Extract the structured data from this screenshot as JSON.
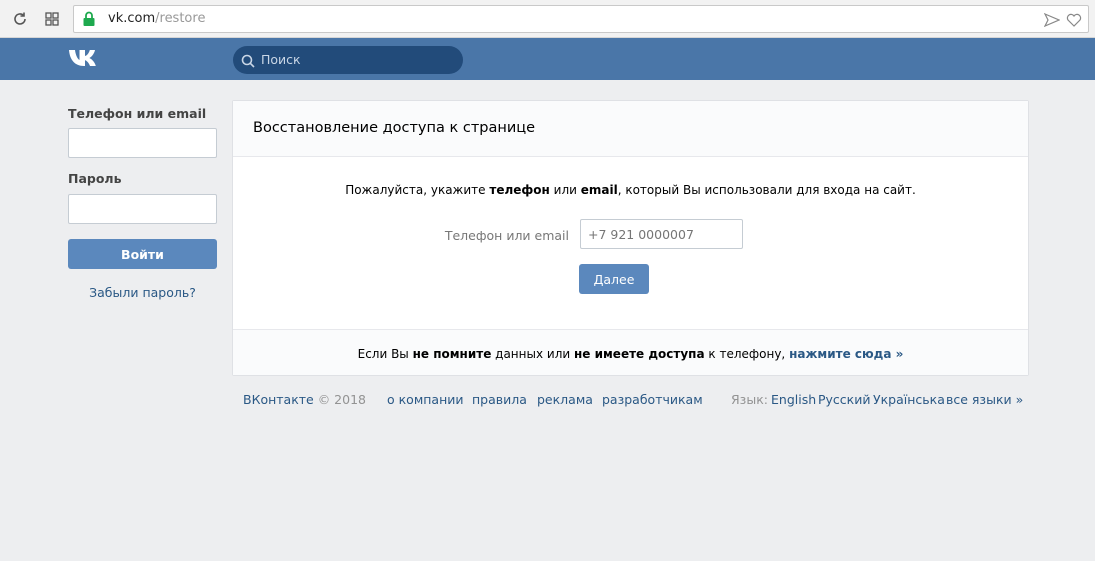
{
  "browser": {
    "url_host": "vk.com",
    "url_path": "/restore"
  },
  "header": {
    "search_placeholder": "Поиск"
  },
  "login": {
    "phone_label": "Телефон или email",
    "password_label": "Пароль",
    "login_button": "Войти",
    "forgot_link": "Забыли пароль?"
  },
  "card": {
    "title": "Восстановление доступа к странице",
    "instruction_1": "Пожалуйста, укажите ",
    "instruction_2": "телефон",
    "instruction_3": " или ",
    "instruction_4": "email",
    "instruction_5": ", который Вы использовали для входа на сайт.",
    "field_label": "Телефон или email",
    "field_placeholder": "+7 921 0000007",
    "next_button": "Далее",
    "footer_1": "Если Вы ",
    "footer_2": "не помните",
    "footer_3": " данных или ",
    "footer_4": "не имеете доступа",
    "footer_5": " к телефону, ",
    "footer_link": "нажмите сюда »"
  },
  "footer": {
    "brand": "ВКонтакте",
    "copyright": " © 2018",
    "links": [
      "о компании",
      "правила",
      "реклама",
      "разработчикам"
    ],
    "lang_label": "Язык:",
    "langs": [
      "English",
      "Русский",
      "Українська",
      "все языки »"
    ]
  },
  "colors": {
    "header_bg": "#4a76a8",
    "button_bg": "#5b88bd",
    "link": "#2a5885"
  }
}
